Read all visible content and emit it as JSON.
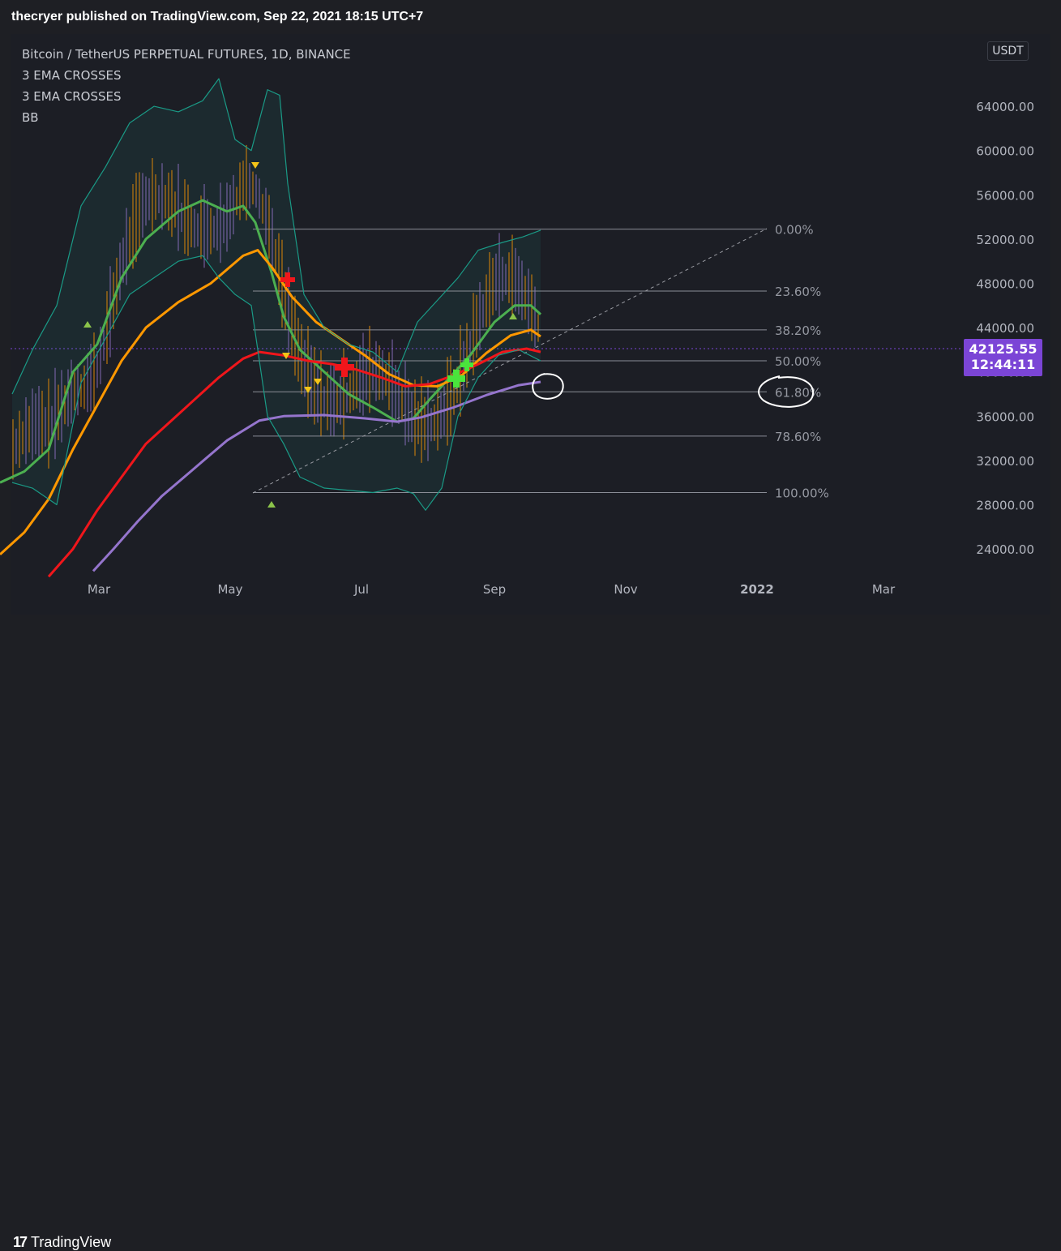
{
  "header": {
    "published": "thecryer published on TradingView.com, Sep 22, 2021 18:15 UTC+7"
  },
  "legend": {
    "symbol": "Bitcoin / TetherUS PERPETUAL FUTURES, 1D, BINANCE",
    "indicators": [
      "3 EMA CROSSES",
      "3 EMA CROSSES",
      "BB"
    ]
  },
  "currency": "USDT",
  "price_tag": {
    "price": "42125.55",
    "countdown": "12:44:11"
  },
  "footer": {
    "logo_text": "TradingView"
  },
  "colors": {
    "background": "#1c1e25",
    "ema_green": "#4caf50",
    "ema_orange": "#ff9800",
    "ema_red": "#f0161b",
    "ema_purple": "#9575cd",
    "bollinger": "#1a9a86",
    "candle_up": "#ff9800",
    "candle_down": "#9575cd",
    "price_tag": "#7b45d6"
  },
  "chart_data": {
    "type": "line",
    "title": "Bitcoin / TetherUS PERPETUAL FUTURES, 1D, BINANCE",
    "y_axis_ticks": [
      "64000.00",
      "60000.00",
      "56000.00",
      "52000.00",
      "48000.00",
      "44000.00",
      "40000.00",
      "36000.00",
      "32000.00",
      "28000.00",
      "24000.00"
    ],
    "x_axis_ticks": [
      "Mar",
      "May",
      "Jul",
      "Sep",
      "Nov",
      "2022",
      "Mar"
    ],
    "ylim": [
      21000,
      69000
    ],
    "fib_levels": [
      {
        "label": "0.00%",
        "price": 52900
      },
      {
        "label": "23.60%",
        "price": 47300
      },
      {
        "label": "38.20%",
        "price": 43800
      },
      {
        "label": "50.00%",
        "price": 41000
      },
      {
        "label": "61.80%",
        "price": 38200
      },
      {
        "label": "78.60%",
        "price": 34200
      },
      {
        "label": "100.00%",
        "price": 29100
      }
    ],
    "series": [
      {
        "name": "EMA fast",
        "color": "#4caf50",
        "points": [
          [
            0,
            30000
          ],
          [
            30,
            31000
          ],
          [
            60,
            33000
          ],
          [
            90,
            40000
          ],
          [
            120,
            42500
          ],
          [
            150,
            48500
          ],
          [
            180,
            52000
          ],
          [
            220,
            54500
          ],
          [
            250,
            55500
          ],
          [
            280,
            54500
          ],
          [
            300,
            55000
          ],
          [
            315,
            53500
          ],
          [
            335,
            49000
          ],
          [
            350,
            45000
          ],
          [
            370,
            42000
          ],
          [
            400,
            40000
          ],
          [
            430,
            38000
          ],
          [
            460,
            36800
          ],
          [
            490,
            35500
          ],
          [
            510,
            35800
          ],
          [
            530,
            37500
          ],
          [
            555,
            39500
          ],
          [
            580,
            41500
          ],
          [
            610,
            44500
          ],
          [
            635,
            46000
          ],
          [
            655,
            46000
          ],
          [
            667,
            45200
          ]
        ]
      },
      {
        "name": "EMA mid",
        "color": "#ff9800",
        "points": [
          [
            0,
            23500
          ],
          [
            30,
            25500
          ],
          [
            60,
            28500
          ],
          [
            90,
            33000
          ],
          [
            120,
            37000
          ],
          [
            150,
            41000
          ],
          [
            180,
            44000
          ],
          [
            220,
            46300
          ],
          [
            260,
            48000
          ],
          [
            300,
            50500
          ],
          [
            318,
            51000
          ],
          [
            335,
            49500
          ],
          [
            360,
            46800
          ],
          [
            390,
            44500
          ],
          [
            420,
            43000
          ],
          [
            450,
            41500
          ],
          [
            480,
            39800
          ],
          [
            510,
            38800
          ],
          [
            540,
            38700
          ],
          [
            570,
            39700
          ],
          [
            600,
            41700
          ],
          [
            630,
            43300
          ],
          [
            655,
            43800
          ],
          [
            667,
            43200
          ]
        ]
      },
      {
        "name": "EMA slow",
        "color": "#f0161b",
        "points": [
          [
            60,
            21500
          ],
          [
            90,
            24000
          ],
          [
            120,
            27500
          ],
          [
            150,
            30500
          ],
          [
            180,
            33500
          ],
          [
            210,
            35500
          ],
          [
            240,
            37500
          ],
          [
            270,
            39500
          ],
          [
            300,
            41200
          ],
          [
            320,
            41800
          ],
          [
            350,
            41500
          ],
          [
            380,
            41000
          ],
          [
            410,
            40700
          ],
          [
            440,
            40200
          ],
          [
            470,
            39500
          ],
          [
            500,
            38700
          ],
          [
            530,
            38900
          ],
          [
            560,
            39700
          ],
          [
            590,
            40700
          ],
          [
            620,
            41800
          ],
          [
            650,
            42100
          ],
          [
            667,
            41800
          ]
        ]
      },
      {
        "name": "EMA 200",
        "color": "#9575cd",
        "points": [
          [
            115,
            22000
          ],
          [
            140,
            24000
          ],
          [
            170,
            26500
          ],
          [
            200,
            28800
          ],
          [
            240,
            31300
          ],
          [
            280,
            33800
          ],
          [
            320,
            35600
          ],
          [
            350,
            36000
          ],
          [
            400,
            36100
          ],
          [
            450,
            35800
          ],
          [
            490,
            35500
          ],
          [
            520,
            35900
          ],
          [
            560,
            36800
          ],
          [
            600,
            37900
          ],
          [
            640,
            38800
          ],
          [
            667,
            39100
          ]
        ]
      },
      {
        "name": "BB upper",
        "color": "#1a9a86",
        "points": [
          [
            15,
            38000
          ],
          [
            40,
            42000
          ],
          [
            70,
            46000
          ],
          [
            100,
            55000
          ],
          [
            130,
            58500
          ],
          [
            160,
            62500
          ],
          [
            190,
            64000
          ],
          [
            220,
            63500
          ],
          [
            250,
            64500
          ],
          [
            270,
            66500
          ],
          [
            290,
            61000
          ],
          [
            310,
            60000
          ],
          [
            330,
            65500
          ],
          [
            345,
            65000
          ],
          [
            355,
            57000
          ],
          [
            375,
            47000
          ],
          [
            400,
            44000
          ],
          [
            430,
            42500
          ],
          [
            460,
            41800
          ],
          [
            490,
            40000
          ],
          [
            515,
            44500
          ],
          [
            540,
            46500
          ],
          [
            565,
            48500
          ],
          [
            590,
            51000
          ],
          [
            620,
            51700
          ],
          [
            645,
            52200
          ],
          [
            667,
            52800
          ]
        ]
      },
      {
        "name": "BB lower",
        "color": "#1a9a86",
        "points": [
          [
            15,
            30000
          ],
          [
            40,
            29500
          ],
          [
            70,
            28000
          ],
          [
            100,
            39000
          ],
          [
            130,
            43000
          ],
          [
            160,
            47000
          ],
          [
            190,
            48500
          ],
          [
            220,
            50000
          ],
          [
            250,
            50500
          ],
          [
            270,
            48500
          ],
          [
            290,
            47000
          ],
          [
            310,
            46000
          ],
          [
            330,
            36000
          ],
          [
            350,
            33500
          ],
          [
            370,
            30500
          ],
          [
            400,
            29500
          ],
          [
            430,
            29300
          ],
          [
            460,
            29100
          ],
          [
            490,
            29500
          ],
          [
            510,
            29000
          ],
          [
            525,
            27500
          ],
          [
            545,
            29500
          ],
          [
            565,
            36000
          ],
          [
            590,
            39500
          ],
          [
            615,
            41500
          ],
          [
            640,
            42000
          ],
          [
            667,
            41000
          ]
        ]
      }
    ],
    "price_markers": [
      {
        "label": "42125.55",
        "price": 42125.55
      }
    ]
  }
}
